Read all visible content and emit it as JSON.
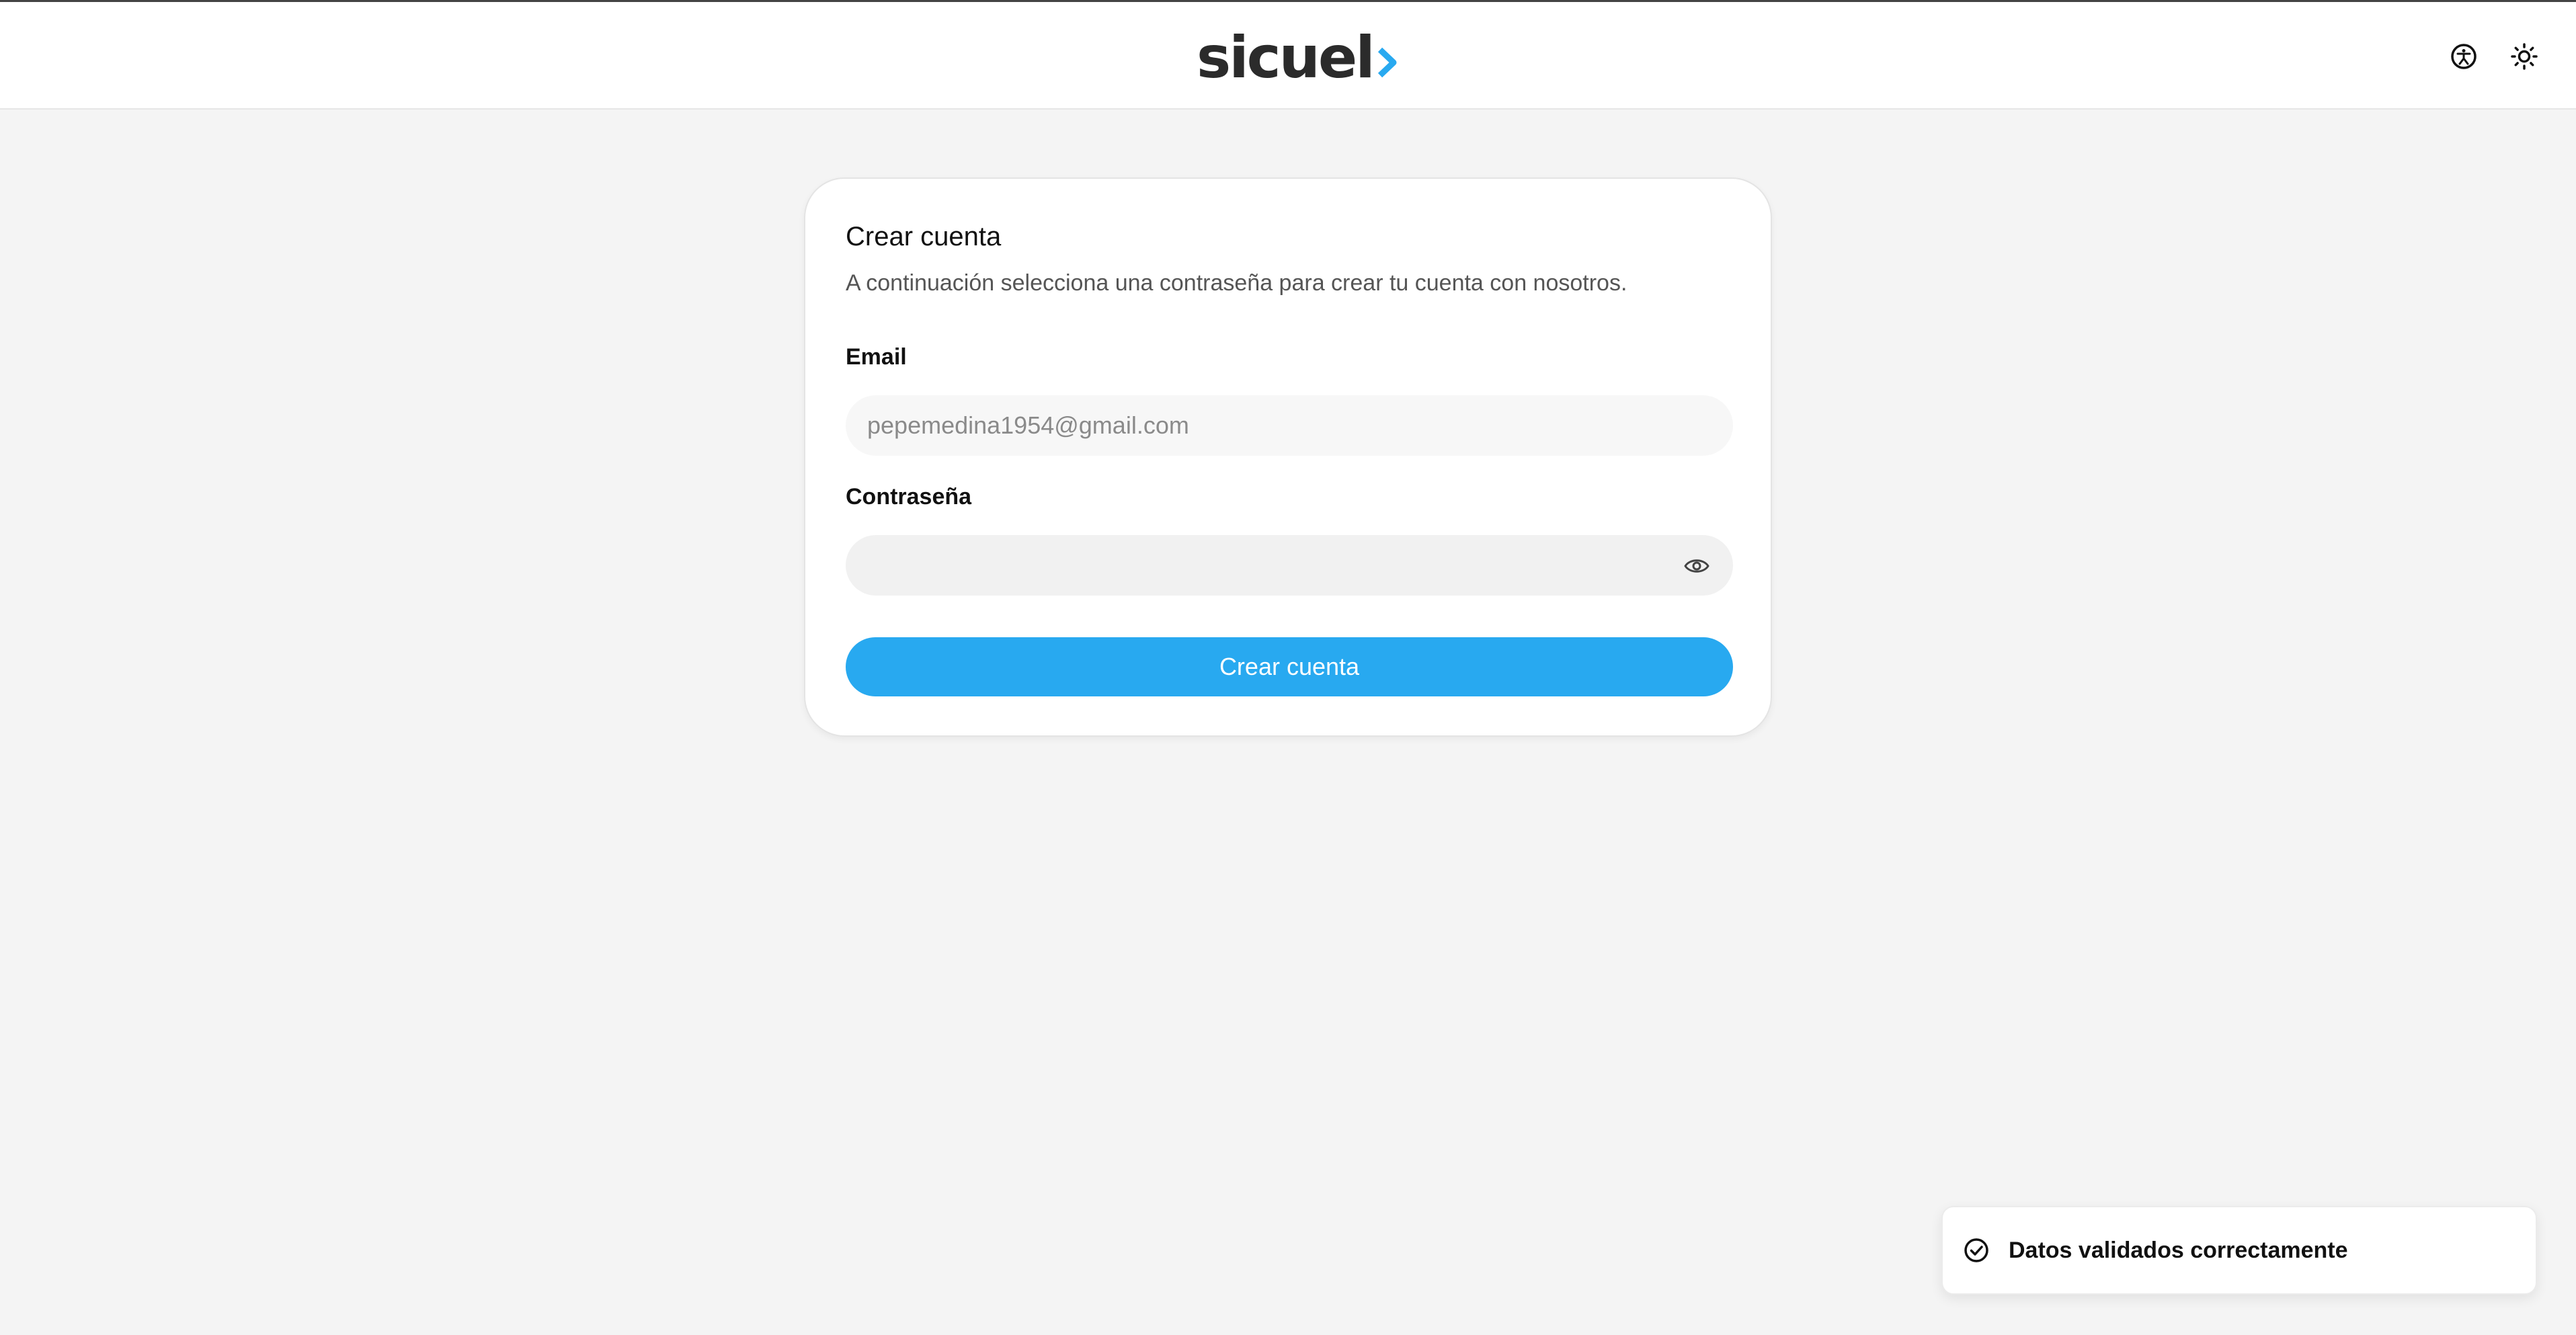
{
  "header": {
    "logo_text": "sicuel",
    "icons": [
      "accessibility-icon",
      "sun-icon"
    ],
    "accent_color": "#28a9f0"
  },
  "form": {
    "title": "Crear cuenta",
    "subtitle": "A continuación selecciona una contraseña para crear tu cuenta con nosotros.",
    "email_label": "Email",
    "email_value": "pepemedina1954@gmail.com",
    "password_label": "Contraseña",
    "password_value": "",
    "submit_label": "Crear cuenta"
  },
  "toast": {
    "message": "Datos validados correctamente",
    "icon": "check-circle-icon"
  }
}
